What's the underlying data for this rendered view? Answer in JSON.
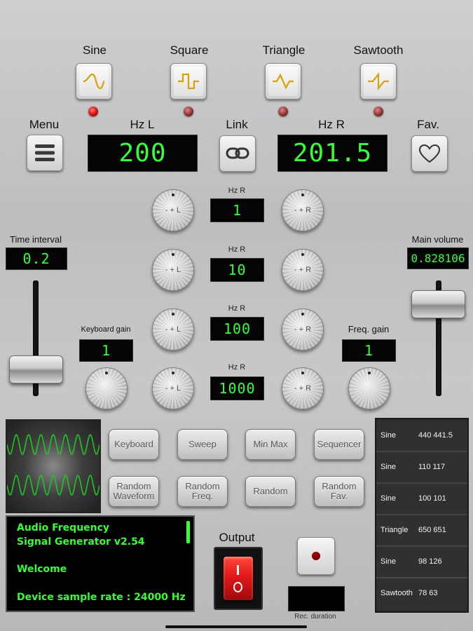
{
  "waveforms": [
    {
      "label": "Sine",
      "active": true
    },
    {
      "label": "Square",
      "active": false
    },
    {
      "label": "Triangle",
      "active": false
    },
    {
      "label": "Sawtooth",
      "active": false
    }
  ],
  "menu": {
    "label": "Menu"
  },
  "hz_left": {
    "label": "Hz L",
    "value": "200"
  },
  "link": {
    "label": "Link"
  },
  "hz_right": {
    "label": "Hz R",
    "value": "201.5"
  },
  "fav": {
    "label": "Fav."
  },
  "steps": [
    {
      "label": "Hz R",
      "value": "1"
    },
    {
      "label": "Hz R",
      "value": "10"
    },
    {
      "label": "Hz R",
      "value": "100"
    },
    {
      "label": "Hz R",
      "value": "1000"
    }
  ],
  "knob_left_label": "- + L",
  "knob_right_label": "- + R",
  "time_interval": {
    "label": "Time interval",
    "value": "0.2"
  },
  "main_volume": {
    "label": "Main volume",
    "value": "0.828106"
  },
  "keyboard_gain": {
    "label": "Keyboard gain",
    "value": "1"
  },
  "freq_gain": {
    "label": "Freq. gain",
    "value": "1"
  },
  "mode_buttons": {
    "keyboard": "Keyboard",
    "sweep": "Sweep",
    "minmax": "Min Max",
    "sequencer": "Sequencer",
    "random_waveform_1": "Random",
    "random_waveform_2": "Waveform",
    "random_freq_1": "Random",
    "random_freq_2": "Freq.",
    "random": "Random",
    "random_fav_1": "Random",
    "random_fav_2": "Fav."
  },
  "favorites": [
    {
      "waveform": "Sine",
      "freqs": "440 441.5"
    },
    {
      "waveform": "Sine",
      "freqs": "110 117"
    },
    {
      "waveform": "Sine",
      "freqs": "100 101"
    },
    {
      "waveform": "Triangle",
      "freqs": "650 651"
    },
    {
      "waveform": "Sine",
      "freqs": "98 126"
    },
    {
      "waveform": "Sawtooth",
      "freqs": "78 63"
    }
  ],
  "terminal": {
    "line1": "Audio Frequency",
    "line2": "Signal Generator v2.54",
    "line3": "Welcome",
    "line4": "Device sample rate : 24000 Hz"
  },
  "output": {
    "label": "Output"
  },
  "record": {
    "duration_label": "Rec. duration"
  },
  "colors": {
    "lcd_green": "#35ff3a",
    "led_red": "#d01010",
    "switch_red": "#e01818"
  }
}
